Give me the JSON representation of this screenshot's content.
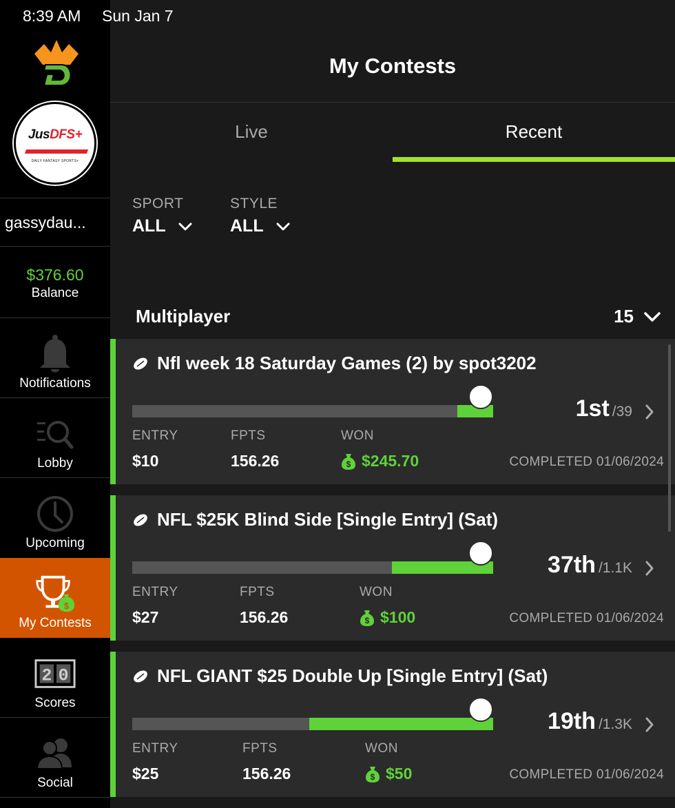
{
  "status_bar": {
    "time": "8:39 AM",
    "date": "Sun Jan 7"
  },
  "sidebar": {
    "avatar": {
      "title_white": "Jus",
      "title_red": "DFS",
      "title_plus": "+",
      "subtitle": "DAILY FANTASY SPORTS+"
    },
    "username": "gassydau...",
    "balance": {
      "amount": "$376.60",
      "label": "Balance"
    },
    "nav": [
      {
        "label": "Notifications",
        "icon": "bell-icon"
      },
      {
        "label": "Lobby",
        "icon": "lobby-search-icon"
      },
      {
        "label": "Upcoming",
        "icon": "clock-icon"
      },
      {
        "label": "My Contests",
        "icon": "trophy-icon",
        "active": true
      },
      {
        "label": "Scores",
        "icon": "scoreboard-icon"
      },
      {
        "label": "Social",
        "icon": "people-icon"
      }
    ]
  },
  "header": {
    "title": "My Contests"
  },
  "tabs": {
    "live": "Live",
    "recent": "Recent",
    "active": "recent"
  },
  "filters": {
    "sport": {
      "label": "SPORT",
      "value": "ALL"
    },
    "style": {
      "label": "STYLE",
      "value": "ALL"
    }
  },
  "section": {
    "title": "Multiplayer",
    "count": "15"
  },
  "contests": [
    {
      "title": "Nfl week 18 Saturday Games (2)  by spot3202",
      "rank": "1st",
      "total": "/39",
      "progress": 0.95,
      "entry_label": "ENTRY",
      "entry": "$10",
      "fpts_label": "FPTS",
      "fpts": "156.26",
      "won_label": "WON",
      "won": "$245.70",
      "completed": "COMPLETED 01/06/2024"
    },
    {
      "title": "NFL $25K Blind Side [Single Entry] (Sat)",
      "rank": "37th",
      "total": "/1.1K",
      "progress": 0.77,
      "entry_label": "ENTRY",
      "entry": "$27",
      "fpts_label": "FPTS",
      "fpts": "156.26",
      "won_label": "WON",
      "won": "$100",
      "completed": "COMPLETED 01/06/2024"
    },
    {
      "title": "NFL GIANT $25 Double Up [Single Entry] (Sat)",
      "rank": "19th",
      "total": "/1.3K",
      "progress": 0.54,
      "entry_label": "ENTRY",
      "entry": "$25",
      "fpts_label": "FPTS",
      "fpts": "156.26",
      "won_label": "WON",
      "won": "$50",
      "completed": "COMPLETED 01/06/2024"
    }
  ],
  "colors": {
    "accent_green": "#5fd23a",
    "tab_underline": "#a4e12b",
    "active_nav": "#d35400",
    "logo_orange": "#f7941d"
  }
}
